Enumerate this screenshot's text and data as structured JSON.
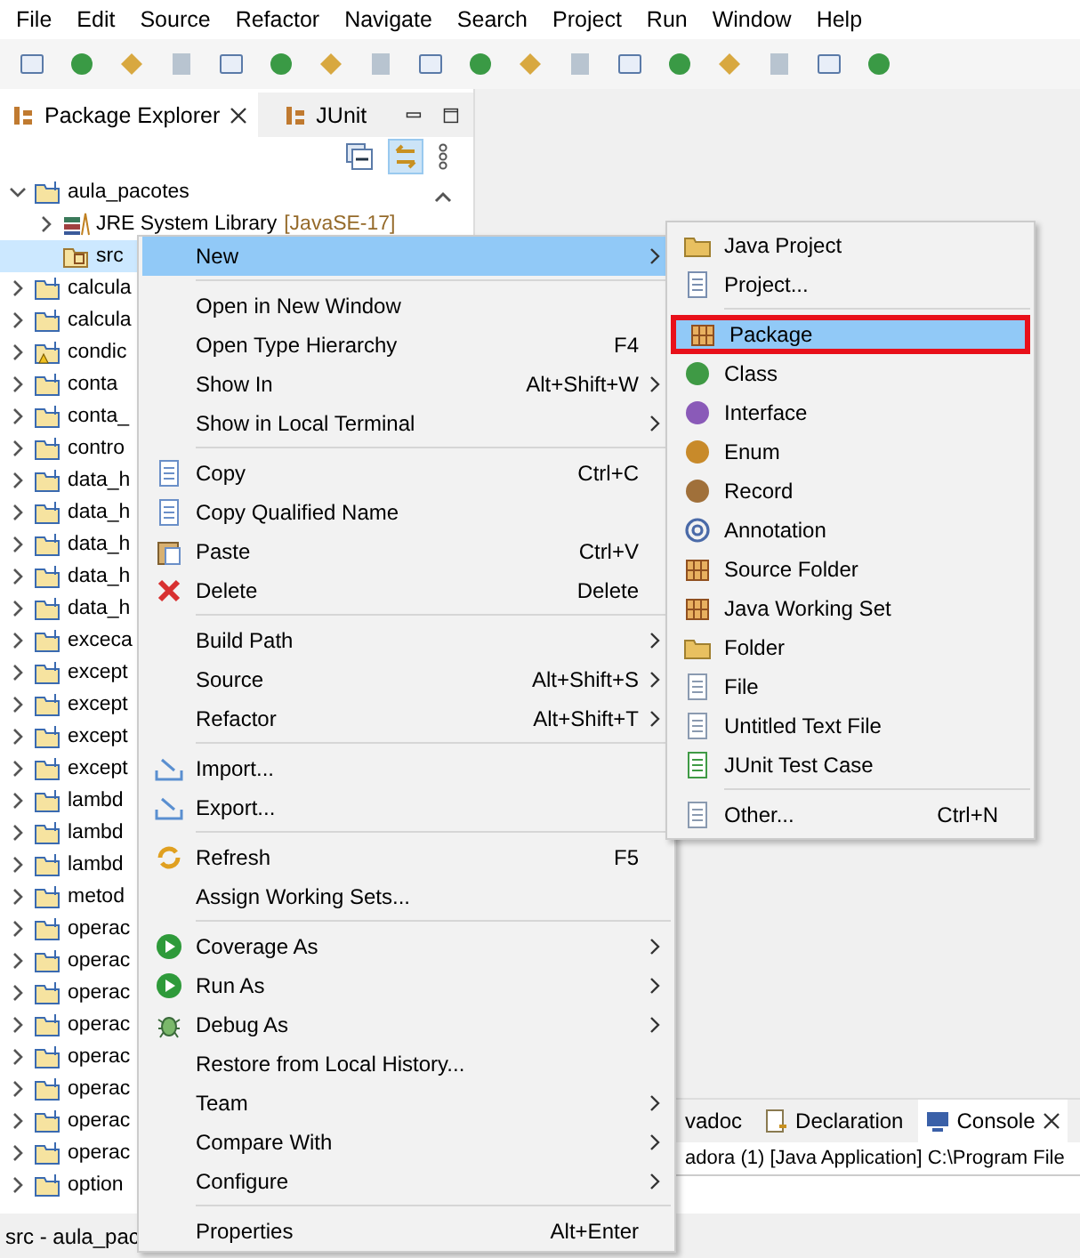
{
  "menu_bar": [
    "File",
    "Edit",
    "Source",
    "Refactor",
    "Navigate",
    "Search",
    "Project",
    "Run",
    "Window",
    "Help"
  ],
  "package_explorer": {
    "tabs": [
      {
        "label": "Package Explorer",
        "selected": true
      },
      {
        "label": "JUnit",
        "selected": false
      }
    ],
    "project": {
      "label": "aula_pacotes",
      "expanded": true,
      "children": [
        {
          "label": "JRE System Library",
          "suffix": "[JavaSE-17]",
          "selected": false
        },
        {
          "label": "src",
          "selected": true
        }
      ]
    },
    "projects": [
      {
        "label": "calcula",
        "warning": false
      },
      {
        "label": "calcula",
        "warning": false
      },
      {
        "label": "condic",
        "warning": true
      },
      {
        "label": "conta",
        "warning": false
      },
      {
        "label": "conta_",
        "warning": false
      },
      {
        "label": "contro",
        "warning": false
      },
      {
        "label": "data_h",
        "warning": false
      },
      {
        "label": "data_h",
        "warning": false
      },
      {
        "label": "data_h",
        "warning": false
      },
      {
        "label": "data_h",
        "warning": false
      },
      {
        "label": "data_h",
        "warning": false
      },
      {
        "label": "exceca",
        "warning": false
      },
      {
        "label": "except",
        "warning": false
      },
      {
        "label": "except",
        "warning": false
      },
      {
        "label": "except",
        "warning": false
      },
      {
        "label": "except",
        "warning": false
      },
      {
        "label": "lambd",
        "warning": false
      },
      {
        "label": "lambd",
        "warning": false
      },
      {
        "label": "lambd",
        "warning": false
      },
      {
        "label": "metod",
        "warning": false
      },
      {
        "label": "operac",
        "warning": false
      },
      {
        "label": "operac",
        "warning": false
      },
      {
        "label": "operac",
        "warning": false
      },
      {
        "label": "operac",
        "warning": false
      },
      {
        "label": "operac",
        "warning": false
      },
      {
        "label": "operac",
        "warning": false
      },
      {
        "label": "operac",
        "warning": false
      },
      {
        "label": "operac",
        "warning": false
      },
      {
        "label": "option",
        "warning": false
      }
    ]
  },
  "bottom_panel": {
    "tabs": [
      {
        "label": "vadoc",
        "selected": false
      },
      {
        "label": "Declaration",
        "selected": false
      },
      {
        "label": "Console",
        "selected": true
      }
    ],
    "console_line": "adora (1) [Java Application] C:\\Program File"
  },
  "status_bar": "src - aula_pac",
  "context_menu": [
    {
      "kind": "item",
      "label": "New",
      "submenu": true,
      "selected": true
    },
    {
      "kind": "separator"
    },
    {
      "kind": "item",
      "label": "Open in New Window",
      "submenu": false,
      "selected": false
    },
    {
      "kind": "item",
      "label": "Open Type Hierarchy",
      "shortcut": "F4",
      "submenu": false,
      "selected": false
    },
    {
      "kind": "item",
      "label": "Show In",
      "shortcut": "Alt+Shift+W",
      "submenu": true,
      "selected": false
    },
    {
      "kind": "item",
      "label": "Show in Local Terminal",
      "submenu": true,
      "selected": false
    },
    {
      "kind": "separator"
    },
    {
      "kind": "item",
      "label": "Copy",
      "shortcut": "Ctrl+C",
      "submenu": false,
      "selected": false
    },
    {
      "kind": "item",
      "label": "Copy Qualified Name",
      "submenu": false,
      "selected": false
    },
    {
      "kind": "item",
      "label": "Paste",
      "shortcut": "Ctrl+V",
      "submenu": false,
      "selected": false
    },
    {
      "kind": "item",
      "label": "Delete",
      "shortcut": "Delete",
      "submenu": false,
      "selected": false
    },
    {
      "kind": "separator"
    },
    {
      "kind": "item",
      "label": "Build Path",
      "submenu": true,
      "selected": false
    },
    {
      "kind": "item",
      "label": "Source",
      "shortcut": "Alt+Shift+S",
      "submenu": true,
      "selected": false
    },
    {
      "kind": "item",
      "label": "Refactor",
      "shortcut": "Alt+Shift+T",
      "submenu": true,
      "selected": false
    },
    {
      "kind": "separator"
    },
    {
      "kind": "item",
      "label": "Import...",
      "submenu": false,
      "selected": false
    },
    {
      "kind": "item",
      "label": "Export...",
      "submenu": false,
      "selected": false
    },
    {
      "kind": "separator"
    },
    {
      "kind": "item",
      "label": "Refresh",
      "shortcut": "F5",
      "submenu": false,
      "selected": false
    },
    {
      "kind": "item",
      "label": "Assign Working Sets...",
      "submenu": false,
      "selected": false
    },
    {
      "kind": "separator"
    },
    {
      "kind": "item",
      "label": "Coverage As",
      "submenu": true,
      "selected": false
    },
    {
      "kind": "item",
      "label": "Run As",
      "submenu": true,
      "selected": false
    },
    {
      "kind": "item",
      "label": "Debug As",
      "submenu": true,
      "selected": false
    },
    {
      "kind": "item",
      "label": "Restore from Local History...",
      "submenu": false,
      "selected": false
    },
    {
      "kind": "item",
      "label": "Team",
      "submenu": true,
      "selected": false
    },
    {
      "kind": "item",
      "label": "Compare With",
      "submenu": true,
      "selected": false
    },
    {
      "kind": "item",
      "label": "Configure",
      "submenu": true,
      "selected": false
    },
    {
      "kind": "separator"
    },
    {
      "kind": "item",
      "label": "Properties",
      "shortcut": "Alt+Enter",
      "submenu": false,
      "selected": false
    }
  ],
  "new_submenu": [
    {
      "kind": "item",
      "label": "Java Project",
      "selected": false,
      "outlined": false
    },
    {
      "kind": "item",
      "label": "Project...",
      "selected": false,
      "outlined": false
    },
    {
      "kind": "separator"
    },
    {
      "kind": "item",
      "label": "Package",
      "selected": true,
      "outlined": true
    },
    {
      "kind": "item",
      "label": "Class",
      "selected": false,
      "outlined": false
    },
    {
      "kind": "item",
      "label": "Interface",
      "selected": false,
      "outlined": false
    },
    {
      "kind": "item",
      "label": "Enum",
      "selected": false,
      "outlined": false
    },
    {
      "kind": "item",
      "label": "Record",
      "selected": false,
      "outlined": false
    },
    {
      "kind": "item",
      "label": "Annotation",
      "selected": false,
      "outlined": false
    },
    {
      "kind": "item",
      "label": "Source Folder",
      "selected": false,
      "outlined": false
    },
    {
      "kind": "item",
      "label": "Java Working Set",
      "selected": false,
      "outlined": false
    },
    {
      "kind": "item",
      "label": "Folder",
      "selected": false,
      "outlined": false
    },
    {
      "kind": "item",
      "label": "File",
      "selected": false,
      "outlined": false
    },
    {
      "kind": "item",
      "label": "Untitled Text File",
      "selected": false,
      "outlined": false
    },
    {
      "kind": "item",
      "label": "JUnit Test Case",
      "selected": false,
      "outlined": false
    },
    {
      "kind": "separator"
    },
    {
      "kind": "item",
      "label": "Other...",
      "shortcut": "Ctrl+N",
      "selected": false,
      "outlined": false
    }
  ]
}
